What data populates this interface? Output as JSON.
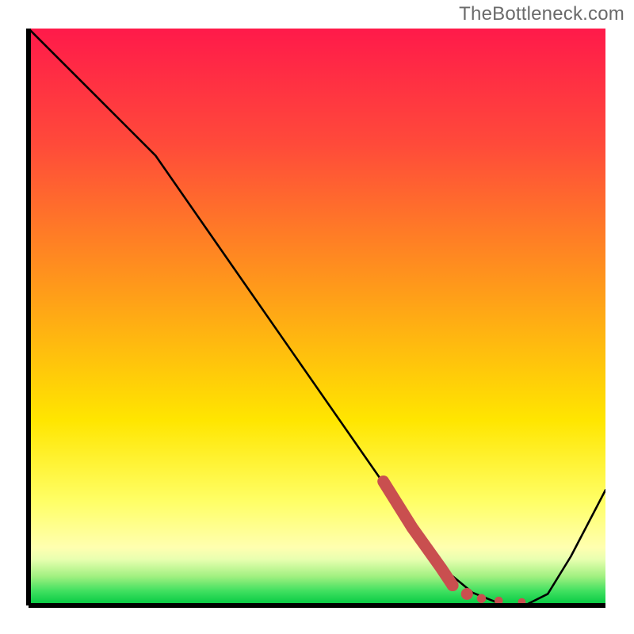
{
  "watermark": "TheBottleneck.com",
  "colors": {
    "top_red": "#ff1a4a",
    "mid_orange": "#ff9a1a",
    "yellow": "#ffe600",
    "pale_yellow": "#ffff99",
    "bottom_green": "#00d646",
    "curve": "#000000",
    "highlight": "#c94f4f",
    "axis": "#000000"
  },
  "gradient_stops": [
    {
      "offset": 0.0,
      "color": "#ff1a4a"
    },
    {
      "offset": 0.2,
      "color": "#ff4a3a"
    },
    {
      "offset": 0.45,
      "color": "#ff9a1a"
    },
    {
      "offset": 0.68,
      "color": "#ffe600"
    },
    {
      "offset": 0.82,
      "color": "#ffff66"
    },
    {
      "offset": 0.9,
      "color": "#ffffb0"
    },
    {
      "offset": 0.92,
      "color": "#e8ffb0"
    },
    {
      "offset": 0.95,
      "color": "#a0f080"
    },
    {
      "offset": 0.975,
      "color": "#40e060"
    },
    {
      "offset": 1.0,
      "color": "#00c840"
    }
  ],
  "chart_data": {
    "type": "line",
    "title": "",
    "xlabel": "",
    "ylabel": "",
    "xlim": [
      0,
      1
    ],
    "ylim": [
      0,
      1
    ],
    "series": [
      {
        "name": "curve",
        "x": [
          0.0,
          0.055,
          0.11,
          0.165,
          0.22,
          0.3,
          0.38,
          0.46,
          0.54,
          0.62,
          0.68,
          0.73,
          0.77,
          0.82,
          0.86,
          0.9,
          0.94,
          1.0
        ],
        "y": [
          1.0,
          0.945,
          0.89,
          0.835,
          0.78,
          0.665,
          0.55,
          0.435,
          0.32,
          0.205,
          0.12,
          0.055,
          0.022,
          0.002,
          0.0,
          0.02,
          0.085,
          0.2
        ]
      }
    ],
    "highlight_segment": {
      "name": "highlight",
      "x": [
        0.615,
        0.64,
        0.665,
        0.69,
        0.715,
        0.735
      ],
      "y": [
        0.215,
        0.175,
        0.135,
        0.1,
        0.065,
        0.035
      ]
    },
    "highlight_dots": {
      "name": "highlight-dots",
      "x": [
        0.735,
        0.76,
        0.785,
        0.815,
        0.855
      ],
      "y": [
        0.035,
        0.02,
        0.012,
        0.008,
        0.006
      ]
    }
  }
}
